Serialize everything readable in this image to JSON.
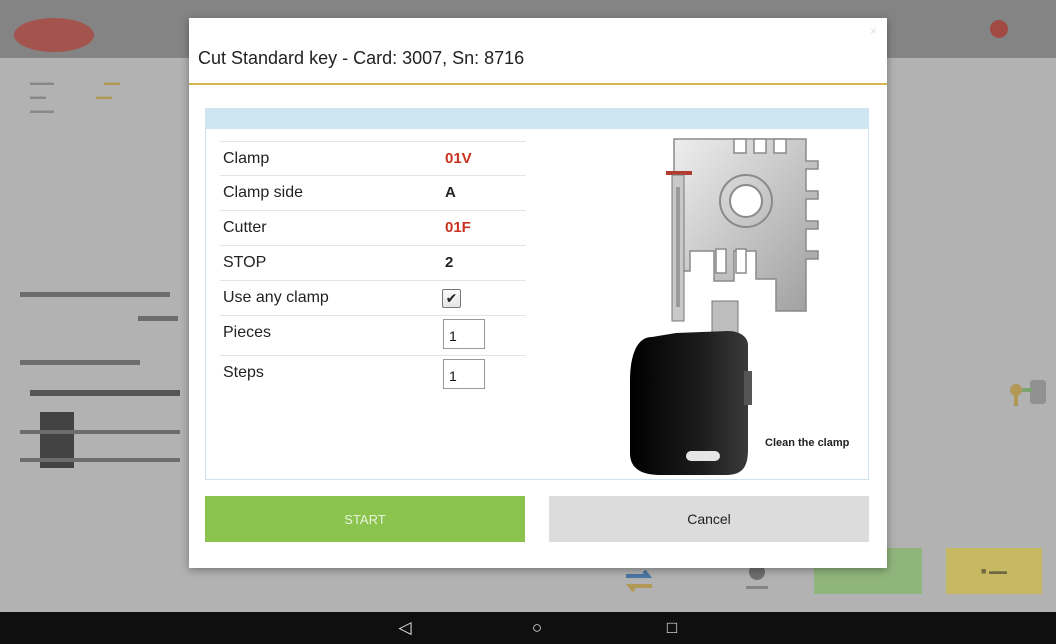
{
  "dialog": {
    "title": "Cut Standard key - Card: 3007, Sn: 8716",
    "close_glyph": "×",
    "illustration_caption": "Clean the clamp",
    "fields": {
      "clamp": {
        "label": "Clamp",
        "value": "01V"
      },
      "clamp_side": {
        "label": "Clamp side",
        "value": "A"
      },
      "cutter": {
        "label": "Cutter",
        "value": "01F"
      },
      "stop": {
        "label": "STOP",
        "value": "2"
      },
      "use_any_clamp": {
        "label": "Use any clamp",
        "checked": true,
        "glyph": "✔"
      },
      "pieces": {
        "label": "Pieces",
        "value": "1"
      },
      "steps": {
        "label": "Steps",
        "value": "1"
      }
    },
    "buttons": {
      "start": "START",
      "cancel": "Cancel"
    }
  },
  "navbar": {
    "back": "◁",
    "home": "○",
    "recents": "□"
  },
  "colors": {
    "accent_line": "#d7b650",
    "red_value": "#c8321f",
    "start_button": "#8ac44f",
    "cancel_button": "#dcdcdc",
    "panel_header": "#cde6f2"
  }
}
